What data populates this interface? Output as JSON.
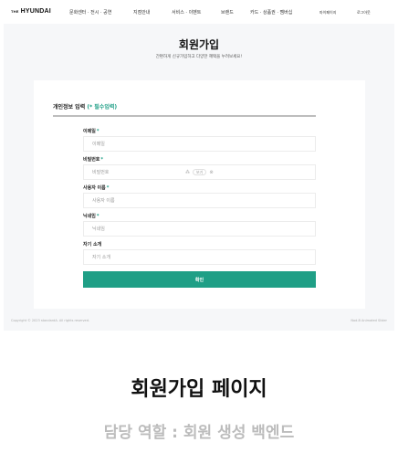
{
  "nav": {
    "logo_prefix": "THE",
    "logo": "HYUNDAI",
    "items": [
      "문화센터 · 전시 · 공연",
      "지점안내",
      "서비스 · 이벤트",
      "브랜드",
      "카드 · 상품권 · 멤버십"
    ],
    "mypage": "마이페이지",
    "logout": "로그아웃"
  },
  "header": {
    "title": "회원가입",
    "subtitle": "간편하게 신규가입하고 다양한 혜택을 누려보세요!"
  },
  "form": {
    "section_title": "개인정보 입력",
    "required_note": "(* 필수입력)",
    "fields": [
      {
        "label": "이메일",
        "required": "*",
        "placeholder": "이메일"
      },
      {
        "label": "비밀번호",
        "required": "*",
        "placeholder": "비밀번호"
      },
      {
        "label": "사용자 이름",
        "required": "*",
        "placeholder": "사용자 이름"
      },
      {
        "label": "닉네임",
        "required": "*",
        "placeholder": "닉네임"
      },
      {
        "label": "자기 소개",
        "required": "",
        "placeholder": "자기 소개"
      }
    ],
    "pw_tools": {
      "left_icon": "⁂",
      "pill": "보기",
      "right_icon": "⊗"
    },
    "submit_label": "확인"
  },
  "footer": {
    "copyright": "Copyright © 2023 standardA. All rights reserved.",
    "right": "Nod-B Animated Slider"
  },
  "caption": {
    "title": "회원가입 페이지",
    "role": "담당 역할 : 회원 생성 백엔드"
  },
  "colors": {
    "accent": "#1f9f86",
    "page_bg": "#f6f7f9",
    "caption_gray": "#bcbcbc"
  }
}
